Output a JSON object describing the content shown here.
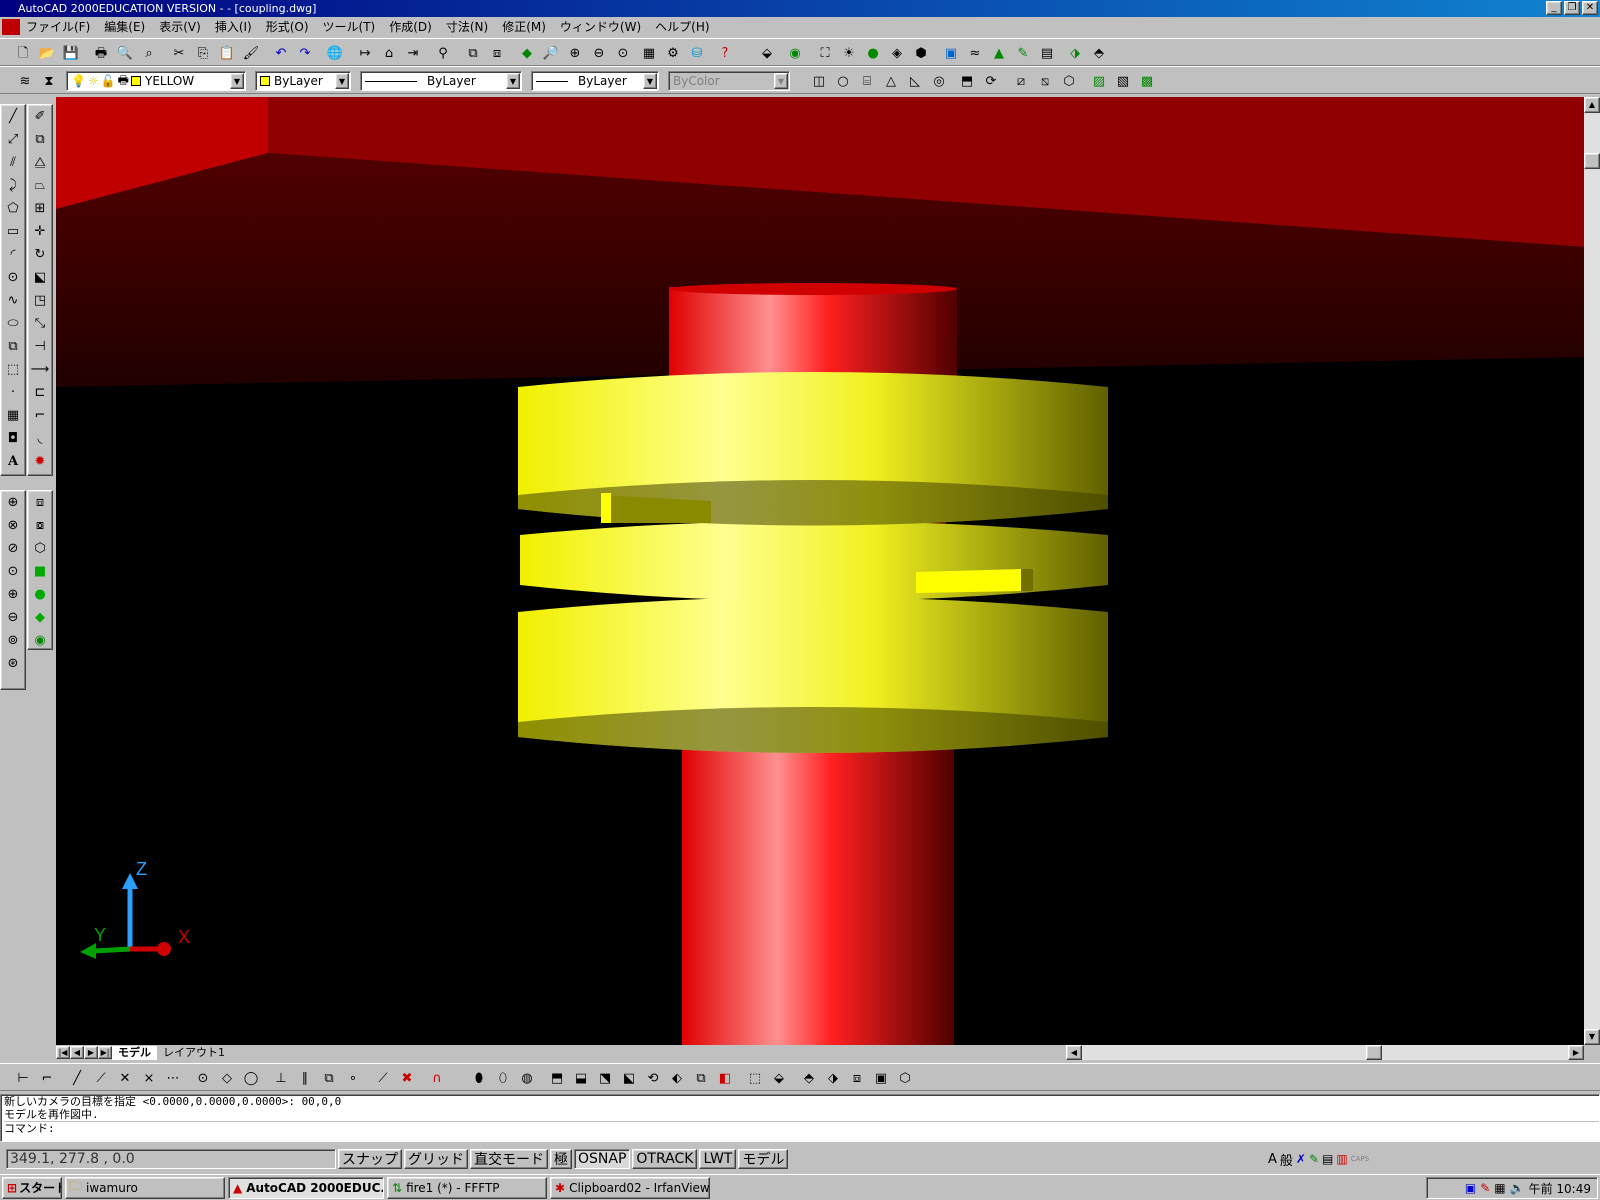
{
  "window": {
    "title": "AutoCAD 2000EDUCATION VERSION - - [coupling.dwg]",
    "controls": [
      "_",
      "❐",
      "✕"
    ]
  },
  "menu": [
    "ファイル(F)",
    "編集(E)",
    "表示(V)",
    "挿入(I)",
    "形式(O)",
    "ツール(T)",
    "作成(D)",
    "寸法(N)",
    "修正(M)",
    "ウィンドウ(W)",
    "ヘルプ(H)"
  ],
  "properties": {
    "layer": "YELLOW",
    "color": "ByLayer",
    "linetype": "ByLayer",
    "lineweight": "ByLayer",
    "plotstyle": "ByColor"
  },
  "ucs": {
    "x": "X",
    "y": "Y",
    "z": "Z"
  },
  "layout_tabs": [
    "モデル",
    "レイアウト1"
  ],
  "command": {
    "lines": [
      "新しいカメラの目標を指定 <0.0000,0.0000,0.0000>: 00,0,0",
      "モデルを再作図中.",
      "コマンド:"
    ]
  },
  "status": {
    "coords": "349.1, 277.8 , 0.0",
    "toggles": [
      "スナップ",
      "グリッド",
      "直交モード",
      "極",
      "OSNAP",
      "OTRACK",
      "LWT",
      "モデル"
    ]
  },
  "taskbar": {
    "start": "スタート",
    "tasks": [
      {
        "label": "iwamuro"
      },
      {
        "label": "AutoCAD 2000EDUC..."
      },
      {
        "label": "fire1 (*) - FFFTP"
      },
      {
        "label": "Clipboard02 - IrfanView"
      }
    ],
    "clock": "午前 10:49"
  },
  "colors": {
    "titlebar": "#000080",
    "shaft": "#e00000",
    "flange": "#f0f020",
    "wall": "#b00000"
  }
}
